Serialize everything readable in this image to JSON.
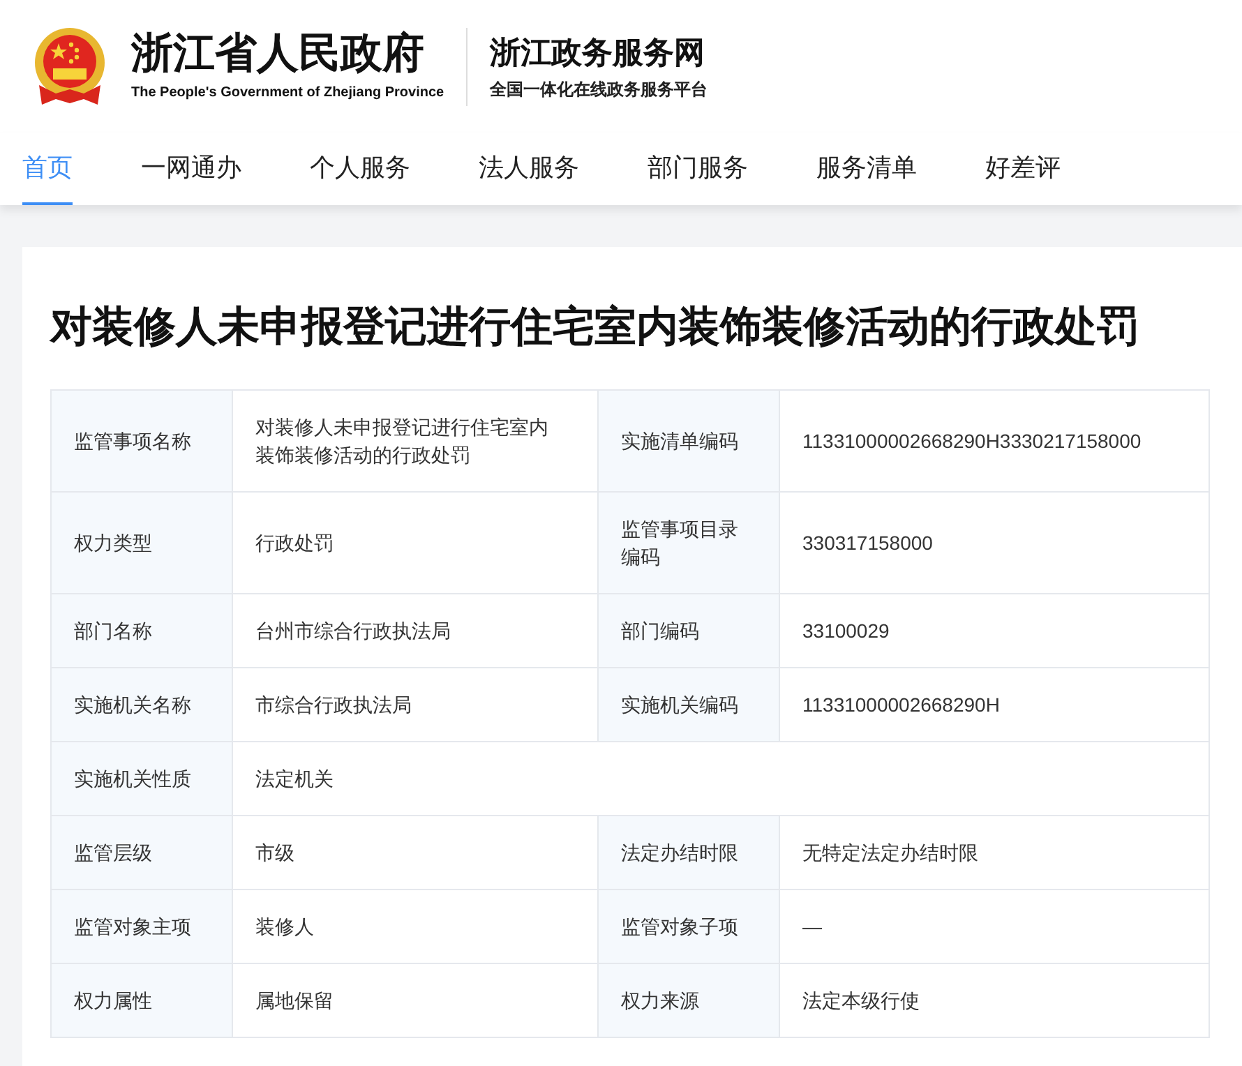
{
  "header": {
    "gov_title": "浙江省人民政府",
    "gov_subtitle": "The People's Government of Zhejiang Province",
    "site_title": "浙江政务服务网",
    "site_subtitle": "全国一体化在线政务服务平台"
  },
  "nav": [
    {
      "label": "首页",
      "selected": true
    },
    {
      "label": "一网通办",
      "selected": false
    },
    {
      "label": "个人服务",
      "selected": false
    },
    {
      "label": "法人服务",
      "selected": false
    },
    {
      "label": "部门服务",
      "selected": false
    },
    {
      "label": "服务清单",
      "selected": false
    },
    {
      "label": "好差评",
      "selected": false
    }
  ],
  "page_title": "对装修人未申报登记进行住宅室内装饰装修活动的行政处罚",
  "table": {
    "rows": [
      [
        {
          "kind": "label",
          "text": "监管事项名称"
        },
        {
          "kind": "value",
          "text": "对装修人未申报登记进行住宅室内装饰装修活动的行政处罚"
        },
        {
          "kind": "label",
          "text": "实施清单编码"
        },
        {
          "kind": "value",
          "text": "11331000002668290H3330217158000"
        }
      ],
      [
        {
          "kind": "label",
          "text": "权力类型"
        },
        {
          "kind": "value",
          "text": "行政处罚"
        },
        {
          "kind": "label",
          "text": "监管事项目录编码"
        },
        {
          "kind": "value",
          "text": "330317158000"
        }
      ],
      [
        {
          "kind": "label",
          "text": "部门名称"
        },
        {
          "kind": "value",
          "text": "台州市综合行政执法局"
        },
        {
          "kind": "label",
          "text": "部门编码"
        },
        {
          "kind": "value",
          "text": "33100029"
        }
      ],
      [
        {
          "kind": "label",
          "text": "实施机关名称"
        },
        {
          "kind": "value",
          "text": "市综合行政执法局"
        },
        {
          "kind": "label",
          "text": "实施机关编码"
        },
        {
          "kind": "value",
          "text": "11331000002668290H"
        }
      ],
      [
        {
          "kind": "label",
          "text": "实施机关性质"
        },
        {
          "kind": "value",
          "text": "法定机关",
          "colspan": 3
        }
      ],
      [
        {
          "kind": "label",
          "text": "监管层级"
        },
        {
          "kind": "value",
          "text": "市级"
        },
        {
          "kind": "label",
          "text": "法定办结时限"
        },
        {
          "kind": "value",
          "text": "无特定法定办结时限"
        }
      ],
      [
        {
          "kind": "label",
          "text": "监管对象主项"
        },
        {
          "kind": "value",
          "text": "装修人"
        },
        {
          "kind": "label",
          "text": "监管对象子项"
        },
        {
          "kind": "value",
          "text": "—"
        }
      ],
      [
        {
          "kind": "label",
          "text": "权力属性"
        },
        {
          "kind": "value",
          "text": "属地保留"
        },
        {
          "kind": "label",
          "text": "权力来源"
        },
        {
          "kind": "value",
          "text": "法定本级行使"
        }
      ]
    ]
  }
}
